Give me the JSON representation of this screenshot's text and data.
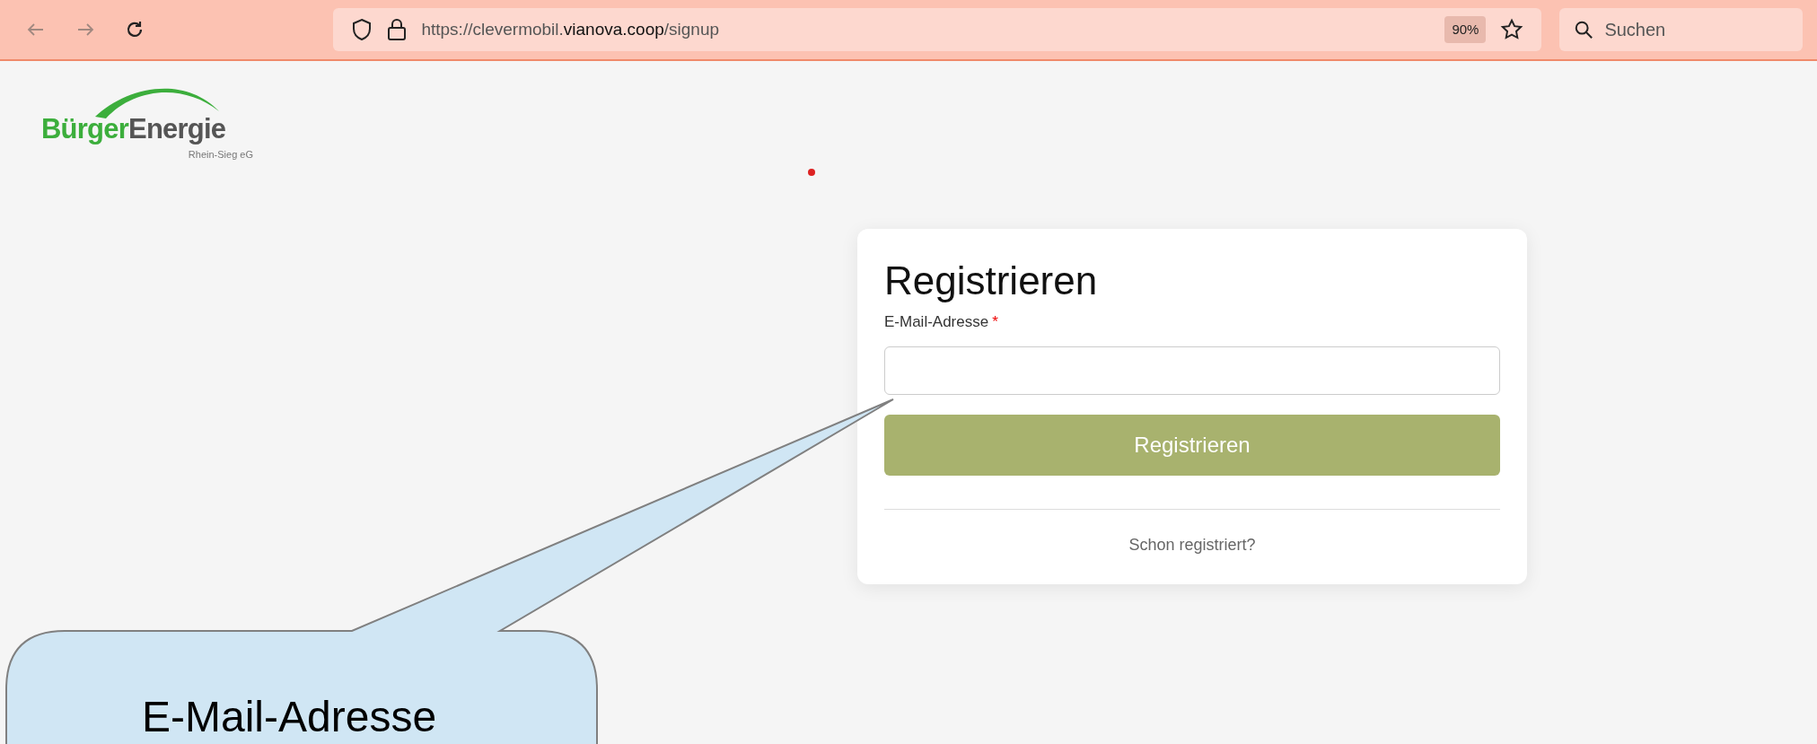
{
  "browser": {
    "url_prefix": "https://clevermobil.",
    "url_domain": "vianova.coop",
    "url_path": "/signup",
    "zoom": "90%",
    "search_placeholder": "Suchen"
  },
  "logo": {
    "word_1": "Bürger",
    "word_2": "Energie",
    "subtitle": "Rhein-Sieg eG"
  },
  "form": {
    "title": "Registrieren",
    "email_label": "E-Mail-Adresse",
    "required_mark": "*",
    "submit_button": "Registrieren",
    "login_link": "Schon registriert?"
  },
  "callout": {
    "text": "E-Mail-Adresse"
  }
}
